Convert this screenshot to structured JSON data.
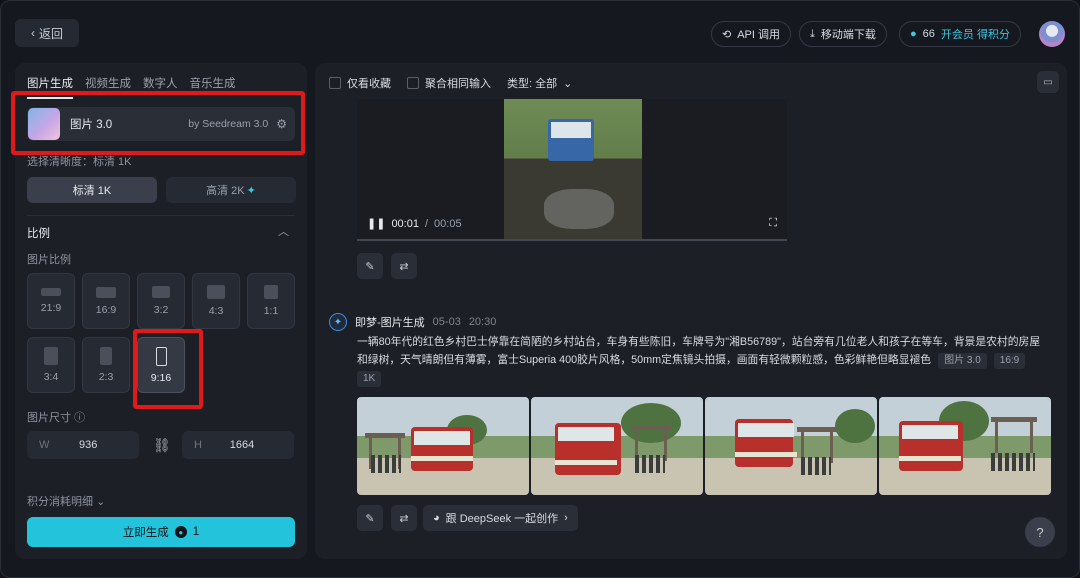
{
  "topbar": {
    "back_label": "返回",
    "api_label": "API 调用",
    "download_label": "移动端下载",
    "credits": "66",
    "member_cta": "开会员 得积分"
  },
  "left": {
    "tabs": [
      "图片生成",
      "视频生成",
      "数字人",
      "音乐生成"
    ],
    "model_name": "图片 3.0",
    "model_by": "by Seedream 3.0",
    "clarity_label": "选择清晰度：标清 1K",
    "quality_standard": "标清 1K",
    "quality_high": "高清 2K",
    "ratio_section": "比例",
    "ratio_sub": "图片比例",
    "ratios": [
      "21:9",
      "16:9",
      "3:2",
      "4:3",
      "1:1",
      "3:4",
      "2:3",
      "9:16"
    ],
    "selected_ratio": "9:16",
    "size_label": "图片尺寸",
    "width_prefix": "W",
    "width": "936",
    "height_prefix": "H",
    "height": "1664",
    "cost_label": "积分消耗明细",
    "generate_label": "立即生成",
    "generate_cost": "1"
  },
  "right": {
    "filter_favorites": "仅看收藏",
    "filter_merge": "聚合相同输入",
    "type_filter": "类型: 全部",
    "video_time_current": "00:01",
    "video_time_sep": "/",
    "video_time_total": "00:05",
    "gen_title": "即梦-图片生成",
    "gen_date": "05-03",
    "gen_time": "20:30",
    "prompt": "一辆80年代的红色乡村巴士停靠在简陋的乡村站台，车身有些陈旧，车牌号为\"湘B56789\"，站台旁有几位老人和孩子在等车，背景是农村的房屋和绿树，天气晴朗但有薄雾，富士Superia 400胶片风格，50mm定焦镜头拍摄，画面有轻微颗粒感，色彩鲜艳但略显褪色",
    "tags": [
      "图片 3.0",
      "16:9",
      "1K"
    ],
    "deepseek_label": "跟 DeepSeek 一起创作"
  }
}
